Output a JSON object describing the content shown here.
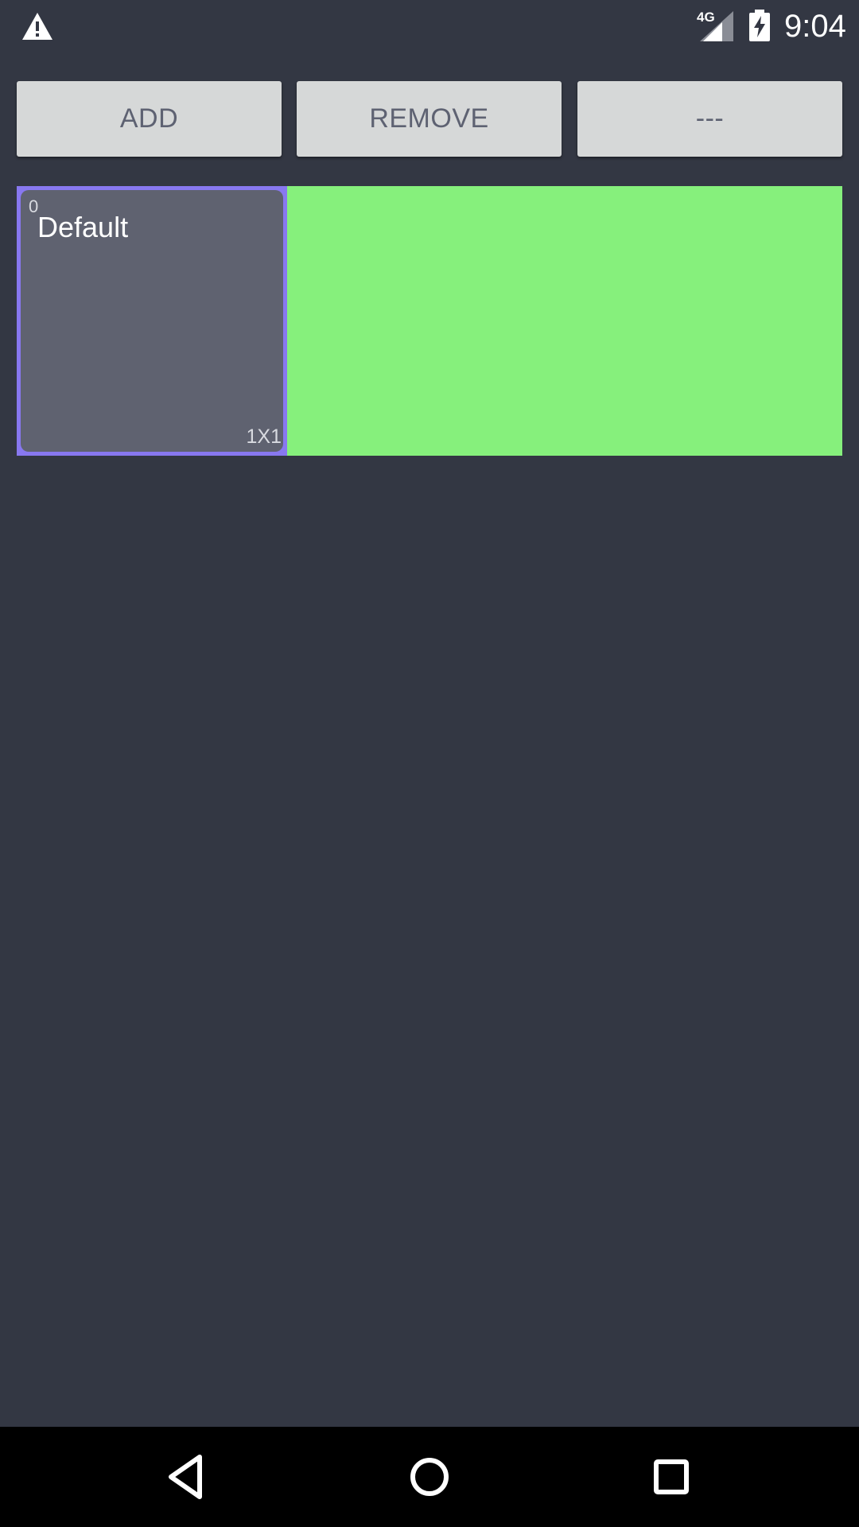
{
  "status_bar": {
    "alert_icon": "warning-icon",
    "network_type": "4G",
    "signal_icon": "signal-icon",
    "battery_icon": "battery-charging-icon",
    "time": "9:04"
  },
  "toolbar": {
    "add_label": "ADD",
    "remove_label": "REMOVE",
    "more_label": "---"
  },
  "grid": {
    "background_color": "#86f07c",
    "tile": {
      "index": "0",
      "name": "Default",
      "size": "1X1",
      "border_color": "#8878f0",
      "fill_color": "#5f6270"
    }
  },
  "nav_bar": {
    "back_icon": "back-icon",
    "home_icon": "home-icon",
    "recents_icon": "recents-icon"
  }
}
